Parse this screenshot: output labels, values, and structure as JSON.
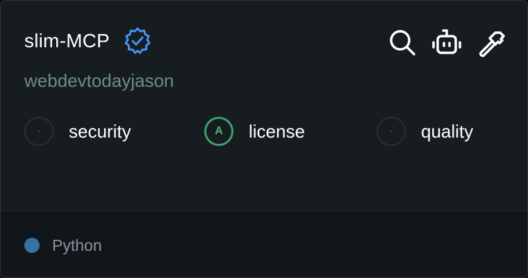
{
  "server": {
    "name": "slim-MCP",
    "owner": "webdevtodayjason",
    "verified_icon": "verified-badge-icon"
  },
  "tools": [
    {
      "name": "search-icon"
    },
    {
      "name": "robot-icon"
    },
    {
      "name": "hammer-icon"
    }
  ],
  "scores": [
    {
      "grade": "-",
      "label": "security"
    },
    {
      "grade": "A",
      "label": "license"
    },
    {
      "grade": "-",
      "label": "quality"
    }
  ],
  "language": {
    "name": "Python",
    "color": "#3572a5"
  },
  "colors": {
    "accent_blue": "#4493f8",
    "grade_a_green": "#3f9f6a"
  }
}
